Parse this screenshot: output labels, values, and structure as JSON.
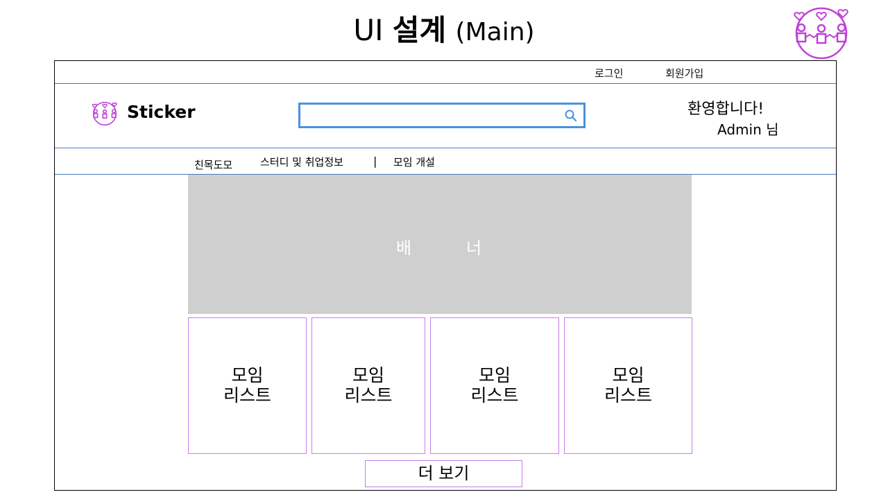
{
  "slide": {
    "title_prefix": "UI",
    "title_main": "설계",
    "title_sub": "(Main)"
  },
  "topbar": {
    "login": "로그인",
    "signup": "회원가입"
  },
  "header": {
    "brand_name": "Sticker",
    "search": {
      "value": "",
      "placeholder": ""
    },
    "welcome": "환영합니다!",
    "user": "Admin 님"
  },
  "nav": {
    "items": [
      {
        "label": "친목도모"
      },
      {
        "label": "스터디 및 취업정보"
      },
      {
        "label": "모임 개설"
      }
    ],
    "separator": "|"
  },
  "banner": {
    "text_left": "배",
    "text_right": "너"
  },
  "cards": [
    {
      "label": "모임\n리스트"
    },
    {
      "label": "모임\n리스트"
    },
    {
      "label": "모임\n리스트"
    },
    {
      "label": "모임\n리스트"
    }
  ],
  "more_button": "더 보기",
  "colors": {
    "accent_purple": "#c77de8",
    "search_border": "#4a90e2",
    "divider_blue": "#4a7ab8",
    "banner_gray": "#d0cfcf"
  },
  "icons": [
    "people-hearts-logo-icon",
    "search-icon"
  ]
}
